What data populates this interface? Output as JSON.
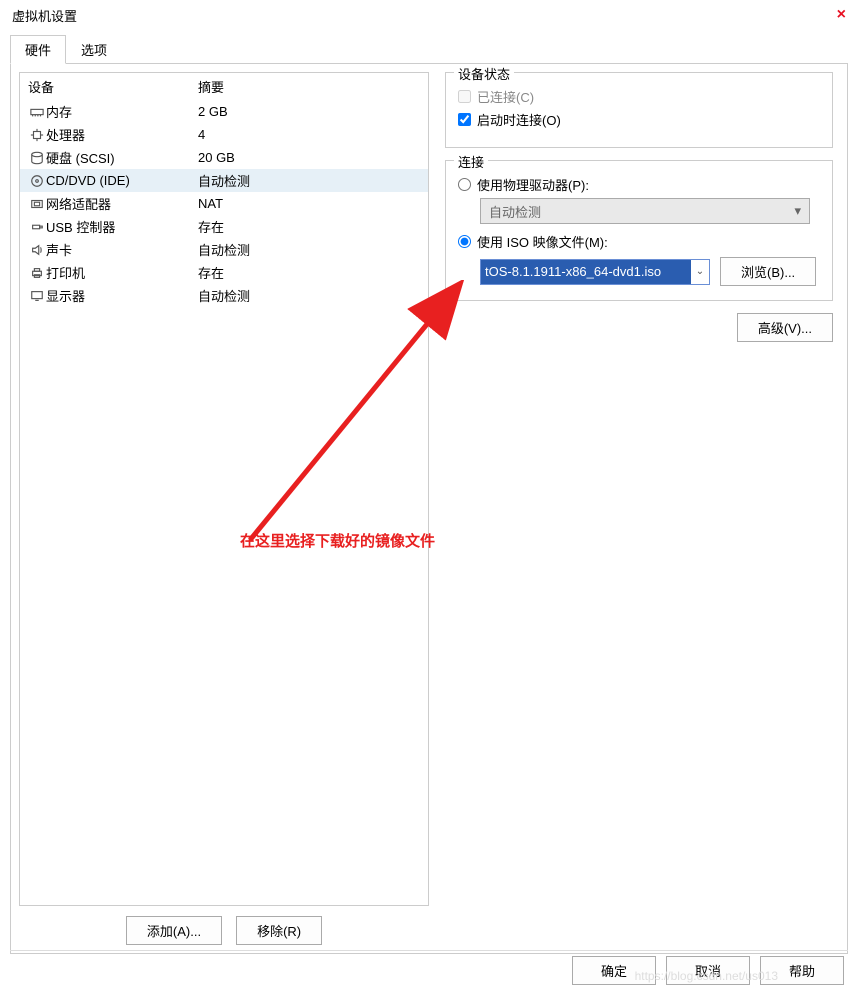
{
  "window": {
    "title": "虚拟机设置",
    "close": "×"
  },
  "tabs": {
    "hardware": "硬件",
    "options": "选项"
  },
  "deviceList": {
    "header": {
      "device": "设备",
      "summary": "摘要"
    },
    "rows": [
      {
        "icon": "memory",
        "name": "内存",
        "summary": "2 GB"
      },
      {
        "icon": "cpu",
        "name": "处理器",
        "summary": "4"
      },
      {
        "icon": "disk",
        "name": "硬盘 (SCSI)",
        "summary": "20 GB"
      },
      {
        "icon": "cd",
        "name": "CD/DVD (IDE)",
        "summary": "自动检测",
        "selected": true
      },
      {
        "icon": "net",
        "name": "网络适配器",
        "summary": "NAT"
      },
      {
        "icon": "usb",
        "name": "USB 控制器",
        "summary": "存在"
      },
      {
        "icon": "sound",
        "name": "声卡",
        "summary": "自动检测"
      },
      {
        "icon": "printer",
        "name": "打印机",
        "summary": "存在"
      },
      {
        "icon": "display",
        "name": "显示器",
        "summary": "自动检测"
      }
    ]
  },
  "leftButtons": {
    "add": "添加(A)...",
    "remove": "移除(R)"
  },
  "status": {
    "legend": "设备状态",
    "connected": "已连接(C)",
    "connectAtPower": "启动时连接(O)"
  },
  "connection": {
    "legend": "连接",
    "physical": "使用物理驱动器(P):",
    "physicalCombo": "自动检测",
    "iso": "使用 ISO 映像文件(M):",
    "isoValue": "tOS-8.1.1911-x86_64-dvd1.iso",
    "browse": "浏览(B)..."
  },
  "advanced": "高级(V)...",
  "bottom": {
    "ok": "确定",
    "cancel": "取消",
    "help": "帮助"
  },
  "annotation": "在这里选择下载好的镜像文件",
  "watermark": "https://blog.csdn.net/us013"
}
